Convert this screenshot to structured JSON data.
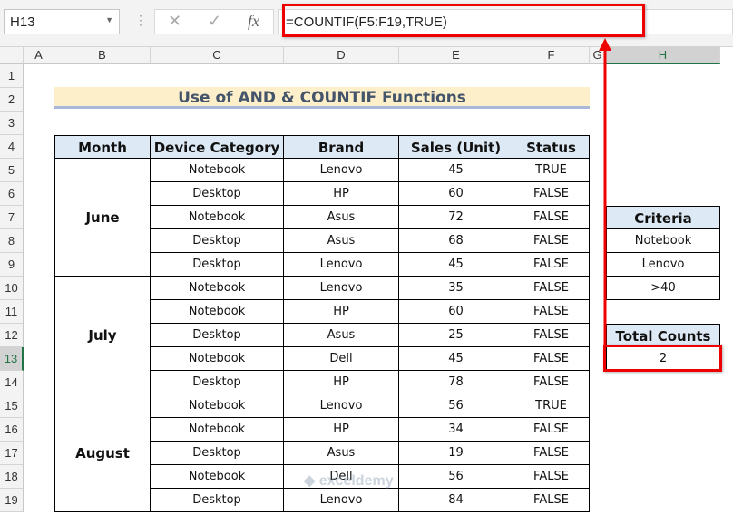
{
  "name_box": "H13",
  "formula_bar": {
    "cancel": "✕",
    "enter": "✓",
    "fx": "fx",
    "formula": "=COUNTIF(F5:F19,TRUE)"
  },
  "columns": [
    "A",
    "B",
    "C",
    "D",
    "E",
    "F",
    "G",
    "H"
  ],
  "rows": [
    "1",
    "2",
    "3",
    "4",
    "5",
    "6",
    "7",
    "8",
    "9",
    "10",
    "11",
    "12",
    "13",
    "14",
    "15",
    "16",
    "17",
    "18",
    "19"
  ],
  "title": "Use of AND & COUNTIF Functions",
  "table": {
    "headers": [
      "Month",
      "Device Category",
      "Brand",
      "Sales (Unit)",
      "Status"
    ],
    "months": [
      "June",
      "July",
      "August"
    ],
    "rows": [
      [
        "Notebook",
        "Lenovo",
        "45",
        "TRUE"
      ],
      [
        "Desktop",
        "HP",
        "60",
        "FALSE"
      ],
      [
        "Notebook",
        "Asus",
        "72",
        "FALSE"
      ],
      [
        "Desktop",
        "Asus",
        "68",
        "FALSE"
      ],
      [
        "Desktop",
        "Lenovo",
        "45",
        "FALSE"
      ],
      [
        "Notebook",
        "Lenovo",
        "35",
        "FALSE"
      ],
      [
        "Notebook",
        "HP",
        "60",
        "FALSE"
      ],
      [
        "Desktop",
        "Asus",
        "25",
        "FALSE"
      ],
      [
        "Notebook",
        "Dell",
        "45",
        "FALSE"
      ],
      [
        "Desktop",
        "HP",
        "78",
        "FALSE"
      ],
      [
        "Notebook",
        "Lenovo",
        "56",
        "TRUE"
      ],
      [
        "Notebook",
        "HP",
        "34",
        "FALSE"
      ],
      [
        "Desktop",
        "Asus",
        "19",
        "FALSE"
      ],
      [
        "Notebook",
        "Dell",
        "56",
        "FALSE"
      ],
      [
        "Desktop",
        "Lenovo",
        "84",
        "FALSE"
      ]
    ]
  },
  "criteria": {
    "header": "Criteria",
    "values": [
      "Notebook",
      "Lenovo",
      ">40"
    ]
  },
  "total": {
    "header": "Total Counts",
    "value": "2"
  },
  "watermark": "exceldemy"
}
